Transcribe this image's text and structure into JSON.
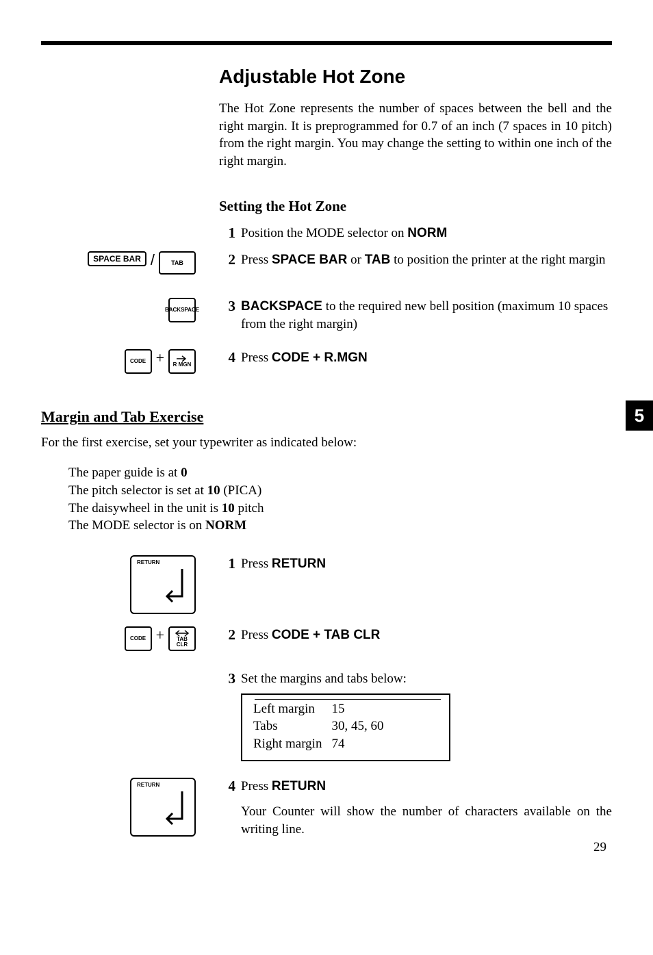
{
  "title": "Adjustable Hot Zone",
  "intro": "The Hot Zone represents the number of spaces between the bell and the right margin. It is preprogrammed for 0.7 of an inch (7 spaces in 10 pitch) from the right margin. You may change the setting to within one inch of the right margin.",
  "subhead": "Setting the Hot Zone",
  "chapter_tab": "5",
  "page_number": "29",
  "keys": {
    "space_bar": "SPACE BAR",
    "tab": "TAB",
    "backspace_l1": "BACK",
    "backspace_l2": "SPACE",
    "code": "CODE",
    "rmgn": "R MGN",
    "return": "RETURN",
    "tabclr": "TAB CLR"
  },
  "steps_a": [
    {
      "num": "1",
      "pre": "Position the MODE selector on ",
      "bold": "NORM",
      "post": ""
    },
    {
      "num": "2",
      "pre": "Press ",
      "bold": "SPACE BAR",
      "mid": " or ",
      "bold2": "TAB",
      "post": " to position the printer at the right margin"
    },
    {
      "num": "3",
      "bold": "BACKSPACE",
      "post": " to the required new bell position (maximum 10 spaces from the right margin)"
    },
    {
      "num": "4",
      "pre": "Press ",
      "bold": "CODE + R.MGN"
    }
  ],
  "exercise_head": "Margin and Tab Exercise",
  "exercise_intro": "For the first exercise, set your typewriter as indicated below:",
  "exercise_list": [
    {
      "plain": "The paper guide is at ",
      "b": "0"
    },
    {
      "plain": "The pitch selector is set at ",
      "b": "10",
      "tail": " (PICA)"
    },
    {
      "plain": "The daisywheel in the unit is ",
      "b": "10",
      "tail": " pitch"
    },
    {
      "plain": "The MODE selector is on ",
      "b": "NORM"
    }
  ],
  "steps_b": [
    {
      "num": "1",
      "pre": "Press ",
      "bold": "RETURN"
    },
    {
      "num": "2",
      "pre": "Press ",
      "bold": "CODE + TAB CLR"
    },
    {
      "num": "3",
      "pre": "Set the margins and tabs below:"
    },
    {
      "num": "4",
      "pre": "Press ",
      "bold": "RETURN",
      "post_para": "Your Counter will show the number of characters available on the writing line."
    }
  ],
  "margin_table": {
    "rows": [
      {
        "label": "Left margin",
        "value": "15"
      },
      {
        "label": "Tabs",
        "value": "30, 45, 60"
      },
      {
        "label": "Right margin",
        "value": "74"
      }
    ]
  }
}
